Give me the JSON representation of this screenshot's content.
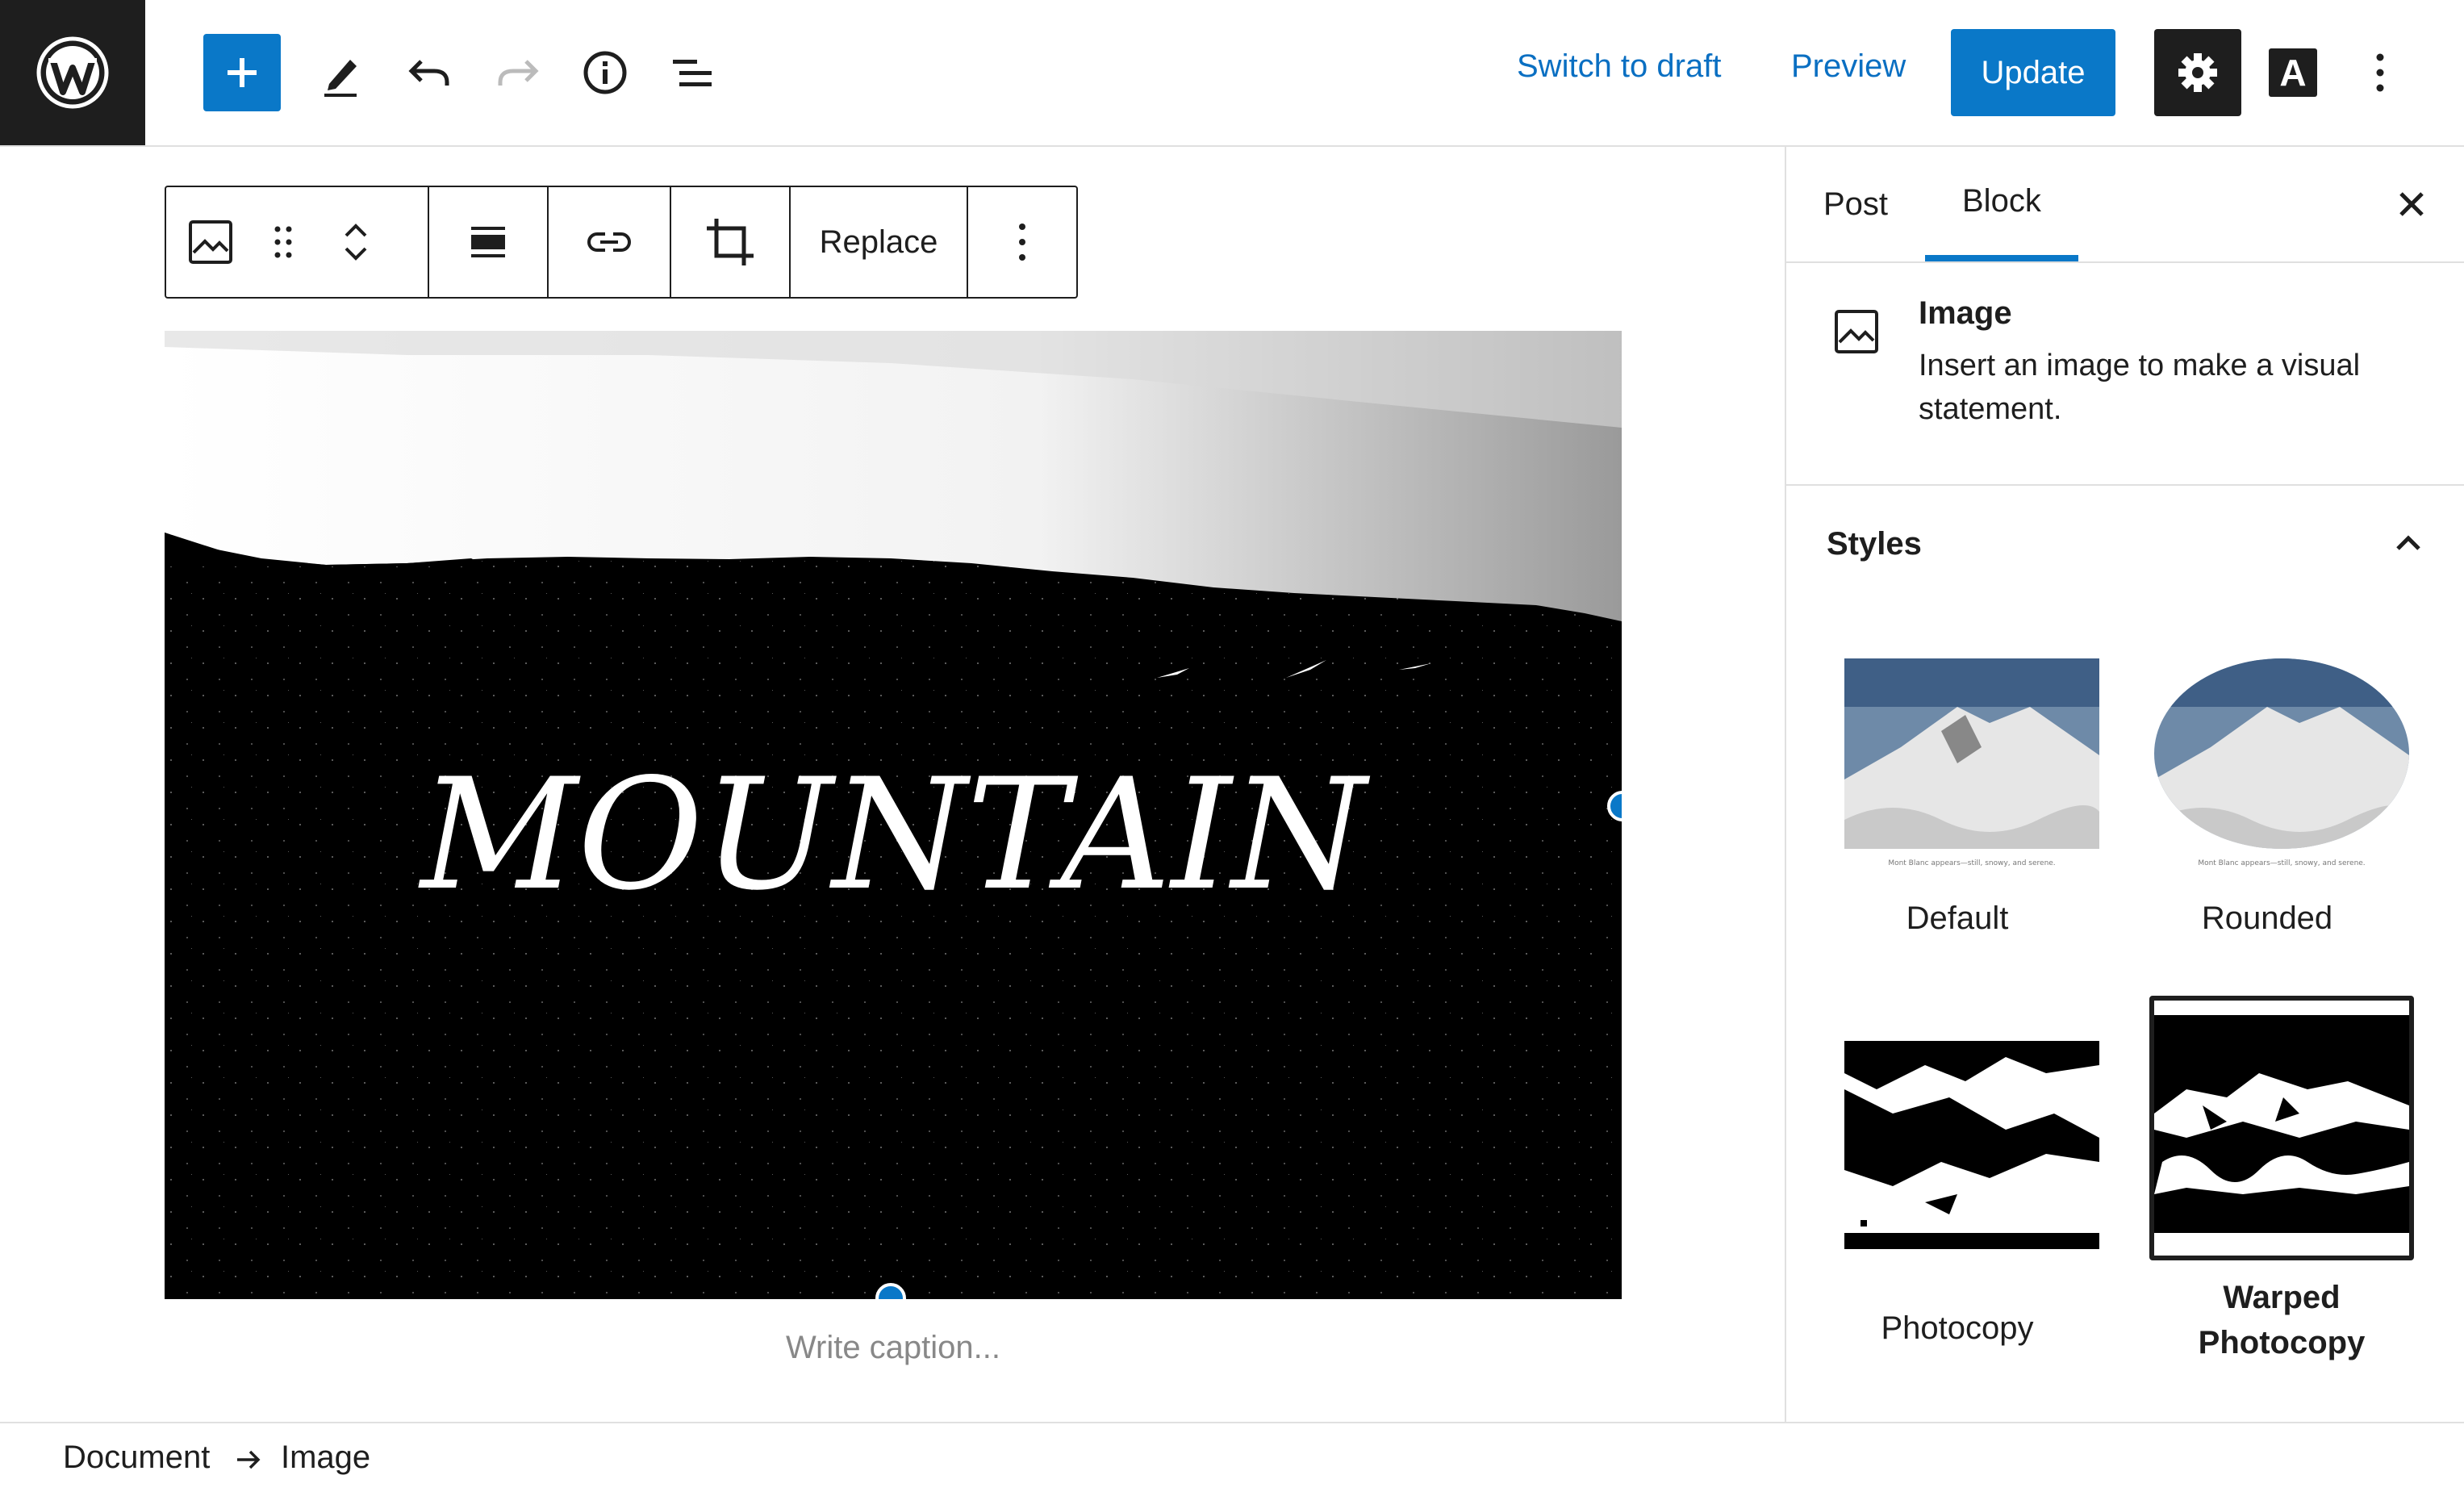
{
  "topbar": {
    "switch_to_draft": "Switch to draft",
    "preview": "Preview",
    "update": "Update",
    "appearance_letter": "A"
  },
  "block_toolbar": {
    "replace": "Replace"
  },
  "image": {
    "title_text": "MOUNTAIN",
    "caption_placeholder": "Write caption..."
  },
  "sidebar": {
    "tabs": [
      "Post",
      "Block"
    ],
    "active_tab": "Block",
    "block_name": "Image",
    "block_description": "Insert an image to make a visual statement.",
    "styles_heading": "Styles",
    "styles": [
      {
        "label": "Default"
      },
      {
        "label": "Rounded"
      },
      {
        "label": "Photocopy"
      },
      {
        "label": "Warped Photocopy",
        "selected": true
      }
    ],
    "thumb_caption": "Mont Blanc appears—still, snowy, and serene."
  },
  "breadcrumb": {
    "items": [
      "Document",
      "Image"
    ]
  },
  "colors": {
    "accent": "#0a78c8",
    "dark": "#1e1e1e"
  }
}
